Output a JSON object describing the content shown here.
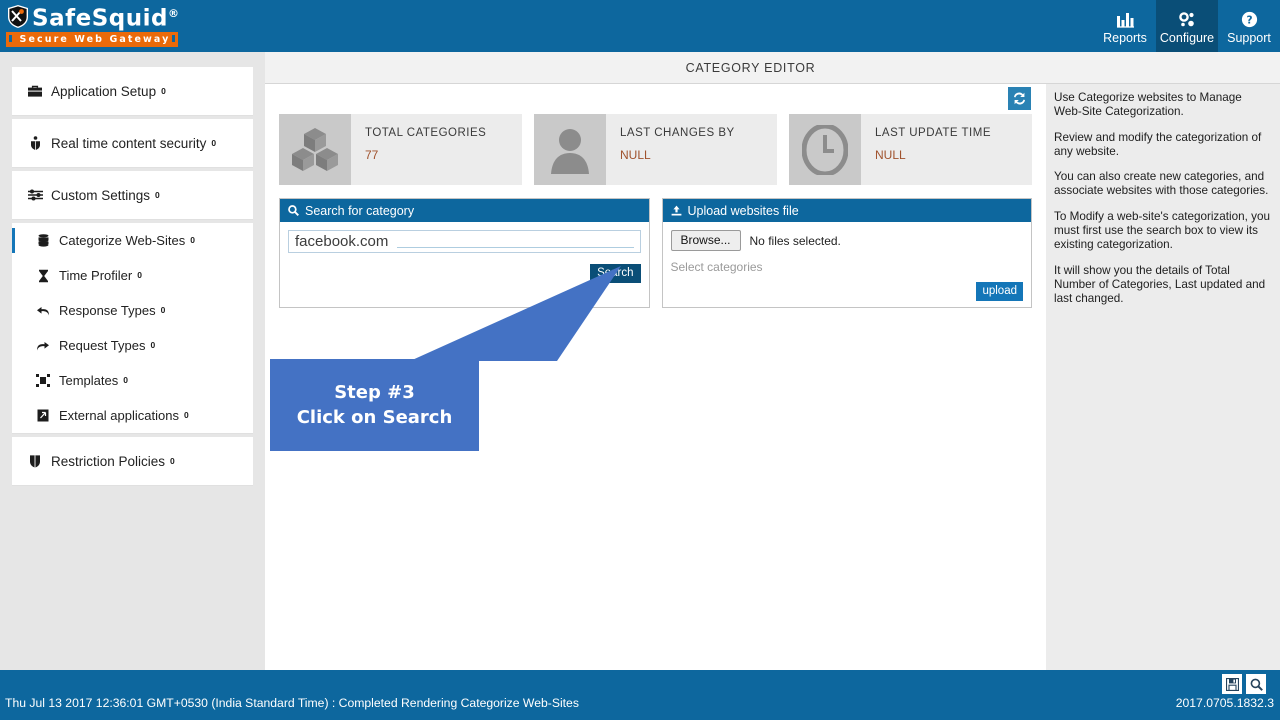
{
  "header": {
    "logo_text": "SafeSquid",
    "logo_reg": "®",
    "logo_tagline": "Secure Web Gateway",
    "nav": [
      {
        "label": "Reports",
        "icon": "chart-icon",
        "active": false
      },
      {
        "label": "Configure",
        "icon": "gears-icon",
        "active": true
      },
      {
        "label": "Support",
        "icon": "help-circle-icon",
        "active": false
      }
    ]
  },
  "page": {
    "title": "CATEGORY EDITOR"
  },
  "sidebar": {
    "groups": [
      {
        "items": [
          {
            "label": "Application Setup",
            "badge": "0",
            "icon": "briefcase-icon"
          }
        ]
      },
      {
        "items": [
          {
            "label": "Real time content security",
            "badge": "0",
            "icon": "shield-person-icon"
          }
        ]
      },
      {
        "items": [
          {
            "label": "Custom Settings",
            "badge": "0",
            "icon": "sliders-icon"
          }
        ]
      },
      {
        "items": [
          {
            "label": "Categorize Web-Sites",
            "badge": "0",
            "icon": "database-icon",
            "active": true
          },
          {
            "label": "Time Profiler",
            "badge": "0",
            "icon": "hourglass-icon"
          },
          {
            "label": "Response Types",
            "badge": "0",
            "icon": "arrow-return-left-icon"
          },
          {
            "label": "Request Types",
            "badge": "0",
            "icon": "arrow-curve-right-icon"
          },
          {
            "label": "Templates",
            "badge": "0",
            "icon": "templates-icon"
          },
          {
            "label": "External applications",
            "badge": "0",
            "icon": "external-app-icon"
          }
        ]
      },
      {
        "items": [
          {
            "label": "Restriction Policies",
            "badge": "0",
            "icon": "shield-icon"
          }
        ]
      }
    ]
  },
  "main": {
    "refresh_icon": "refresh-icon",
    "stats": [
      {
        "title": "TOTAL CATEGORIES",
        "value": "77",
        "icon": "cubes-icon"
      },
      {
        "title": "LAST CHANGES BY",
        "value": "NULL",
        "icon": "user-icon"
      },
      {
        "title": "LAST UPDATE TIME",
        "value": "NULL",
        "icon": "clock-icon"
      }
    ],
    "search_panel": {
      "title": "Search for category",
      "icon": "search-icon",
      "input_value": "facebook.com",
      "input_placeholder": "Search for category",
      "button_label": "Search"
    },
    "upload_panel": {
      "title": "Upload websites file",
      "icon": "upload-icon",
      "browse_label": "Browse...",
      "file_status": "No files selected.",
      "select_categories": "Select categories",
      "upload_label": "upload"
    }
  },
  "help": {
    "paragraphs": [
      "Use Categorize websites to Manage Web-Site Categorization.",
      "Review and modify the categorization of any website.",
      "You can also create new categories, and associate websites with those categories.",
      "To Modify a web-site's categorization, you must first use the search box to view its existing categorization.",
      "It will show you the details of Total Number of Categories, Last updated and last changed."
    ]
  },
  "callout": {
    "line1": "Step #3",
    "line2": "Click on Search",
    "color": "#4472c4"
  },
  "footer": {
    "status": "Thu Jul 13 2017 12:36:01 GMT+0530 (India Standard Time) : Completed Rendering Categorize Web-Sites",
    "version": "2017.0705.1832.3",
    "icons": [
      {
        "name": "save-icon"
      },
      {
        "name": "search-icon"
      }
    ]
  },
  "colors": {
    "header_blue": "#0d679e",
    "active_navy": "#0a4e77",
    "accent_orange": "#eb6a0a",
    "stat_value": "#a0522d"
  }
}
